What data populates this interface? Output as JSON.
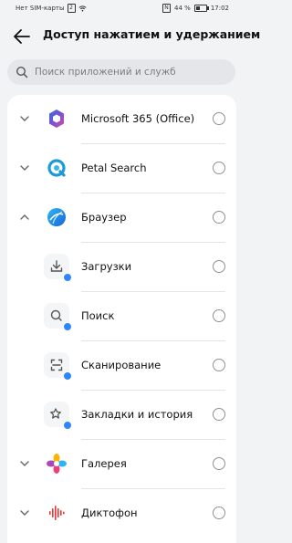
{
  "status_bar": {
    "carrier": "Нет SIM-карты",
    "sim_badge": "2",
    "nfc": "N",
    "battery": "44 %",
    "battery_level": 0.44,
    "time": "17:02"
  },
  "header": {
    "title": "Доступ нажатием и удержанием"
  },
  "search": {
    "placeholder": "Поиск приложений и служб",
    "value": ""
  },
  "items": [
    {
      "label": "Microsoft 365 (Office)",
      "icon": "microsoft-365-icon",
      "level": 0,
      "expanded": false,
      "selected": false
    },
    {
      "label": "Petal Search",
      "icon": "petal-search-icon",
      "level": 0,
      "expanded": false,
      "selected": false
    },
    {
      "label": "Браузер",
      "icon": "browser-icon",
      "level": 0,
      "expanded": true,
      "selected": false
    },
    {
      "label": "Загрузки",
      "icon": "downloads-icon",
      "level": 1,
      "selected": false
    },
    {
      "label": "Поиск",
      "icon": "search-icon",
      "level": 1,
      "selected": false
    },
    {
      "label": "Сканирование",
      "icon": "scan-icon",
      "level": 1,
      "selected": false
    },
    {
      "label": "Закладки и история",
      "icon": "bookmarks-icon",
      "level": 1,
      "selected": false
    },
    {
      "label": "Галерея",
      "icon": "gallery-icon",
      "level": 0,
      "expanded": false,
      "selected": false
    },
    {
      "label": "Диктофон",
      "icon": "recorder-icon",
      "level": 0,
      "expanded": false,
      "selected": false
    }
  ],
  "colors": {
    "background": "#f1f3f5",
    "card": "#ffffff",
    "accent": "#2f86f6"
  }
}
